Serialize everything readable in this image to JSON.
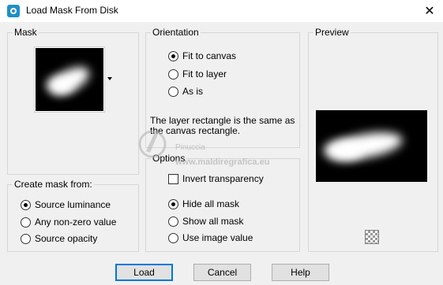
{
  "window": {
    "title": "Load Mask From Disk",
    "close_glyph": "✕"
  },
  "mask_group": {
    "label": "Mask",
    "dropdown_icon": "chevron-down-icon"
  },
  "create_from_group": {
    "label": "Create mask from:",
    "options": [
      {
        "label": "Source luminance",
        "checked": true
      },
      {
        "label": "Any non-zero value",
        "checked": false
      },
      {
        "label": "Source opacity",
        "checked": false
      }
    ]
  },
  "orientation_group": {
    "label": "Orientation",
    "options": [
      {
        "label": "Fit to canvas",
        "checked": true
      },
      {
        "label": "Fit to layer",
        "checked": false
      },
      {
        "label": "As is",
        "checked": false
      }
    ],
    "description": "The layer rectangle is the same as the canvas rectangle."
  },
  "options_group": {
    "label": "Options",
    "invert_label": "Invert transparency",
    "invert_checked": false,
    "options": [
      {
        "label": "Hide all mask",
        "checked": true
      },
      {
        "label": "Show all mask",
        "checked": false
      },
      {
        "label": "Use image value",
        "checked": false
      }
    ]
  },
  "preview_group": {
    "label": "Preview"
  },
  "watermark": {
    "line1": "Pinuccia",
    "line2": "www.maldiregrafica.eu"
  },
  "buttons": {
    "load": "Load",
    "cancel": "Cancel",
    "help": "Help"
  },
  "colors": {
    "dialog_bg": "#f0f0f0",
    "default_button_border": "#0078d7",
    "app_icon": "#1e90c8"
  }
}
